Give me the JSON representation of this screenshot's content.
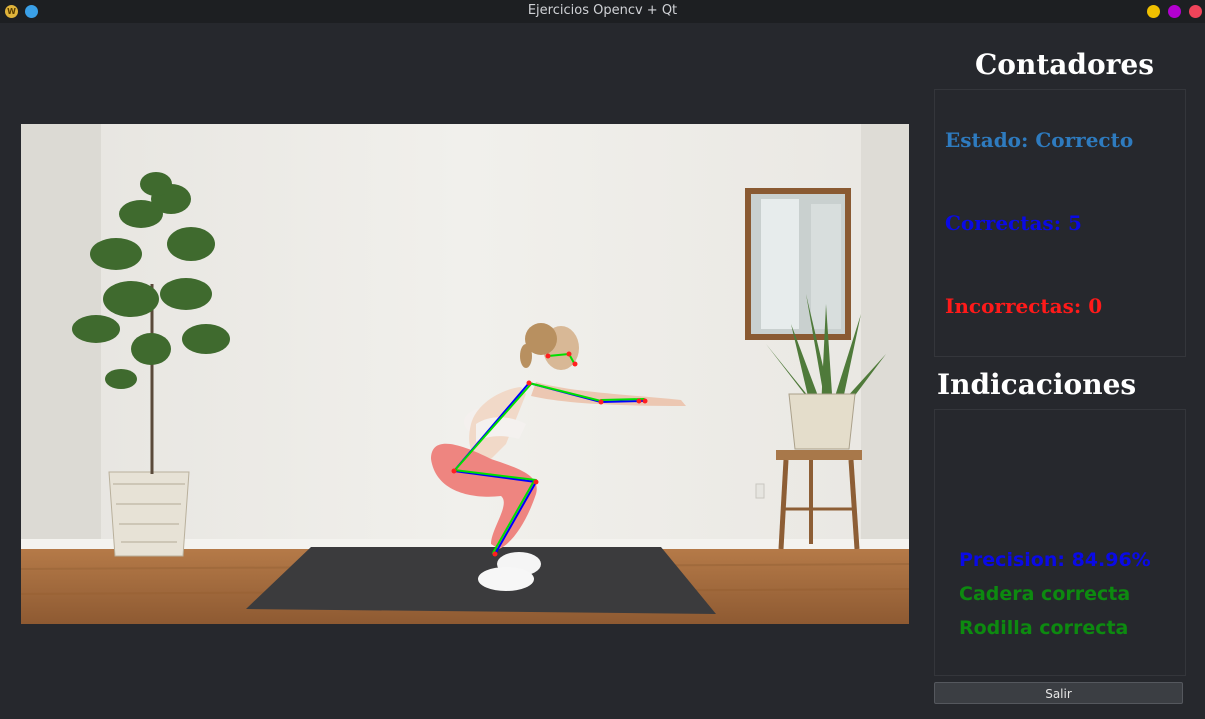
{
  "window": {
    "title": "Ejercicios Opencv + Qt",
    "app_icon_letter": "W"
  },
  "counters": {
    "title": "Contadores",
    "estado": "Estado: Correcto",
    "correctas": "Correctas: 5",
    "incorrectas": "Incorrectas: 0",
    "colors": {
      "estado": "#2e7bbf",
      "correctas": "#0a0ae6",
      "incorrectas": "#ff1a1a"
    }
  },
  "indications": {
    "title": "Indicaciones",
    "precision": "Precision: 84.96%",
    "cadera": "Cadera correcta",
    "rodilla": "Rodilla correcta",
    "colors": {
      "precision": "#0a0ae6",
      "ok": "#0d8a10"
    }
  },
  "buttons": {
    "exit_label": "Salir"
  },
  "video": {
    "description_icon": "pose-skeleton-overlay"
  }
}
